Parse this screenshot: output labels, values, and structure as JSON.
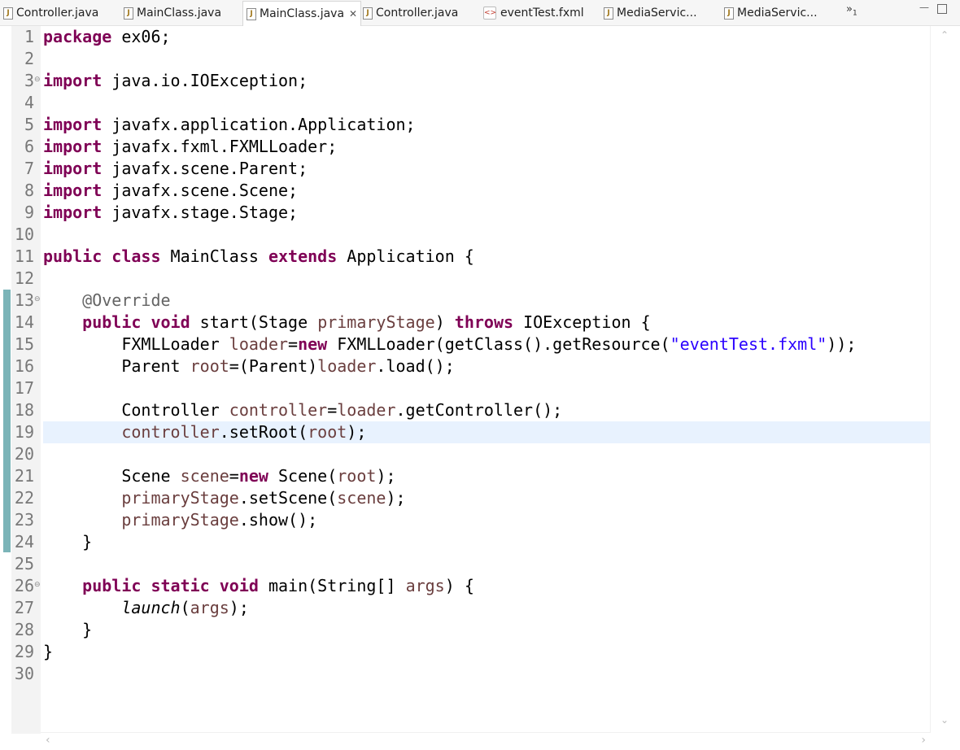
{
  "tabs": [
    {
      "label": "Controller.java",
      "icon": "java-file-icon"
    },
    {
      "label": "MainClass.java",
      "icon": "java-file-icon"
    },
    {
      "label": "MainClass.java",
      "icon": "java-file-icon",
      "active": true
    },
    {
      "label": "Controller.java",
      "icon": "java-file-icon"
    },
    {
      "label": "eventTest.fxml",
      "icon": "xml-file-icon"
    },
    {
      "label": "MediaServic...",
      "icon": "java-file-icon"
    },
    {
      "label": "MediaServic...",
      "icon": "java-file-icon"
    }
  ],
  "tab_overflow": {
    "symbol": "»",
    "count": "1"
  },
  "file_icon_glyph": "J",
  "xml_icon_glyph": "<>",
  "close_glyph": "✕",
  "colors": {
    "keyword": "#7f0055",
    "string": "#2a00ff",
    "annotation": "#646464",
    "variable": "#6a3e3e",
    "current_line": "#e8f2fe",
    "change_bar": "#7bb4b8"
  },
  "editor": {
    "current_line": 19,
    "lines": [
      {
        "n": "1",
        "code": "<span class=\"kw\">package</span> ex06;"
      },
      {
        "n": "2",
        "code": ""
      },
      {
        "n": "3",
        "fold": true,
        "code": "<span class=\"kw\">import</span> java.io.IOException;"
      },
      {
        "n": "4",
        "code": ""
      },
      {
        "n": "5",
        "code": "<span class=\"kw\">import</span> javafx.application.Application;"
      },
      {
        "n": "6",
        "code": "<span class=\"kw\">import</span> javafx.fxml.FXMLLoader;"
      },
      {
        "n": "7",
        "code": "<span class=\"kw\">import</span> javafx.scene.Parent;"
      },
      {
        "n": "8",
        "code": "<span class=\"kw\">import</span> javafx.scene.Scene;"
      },
      {
        "n": "9",
        "code": "<span class=\"kw\">import</span> javafx.stage.Stage;"
      },
      {
        "n": "10",
        "code": ""
      },
      {
        "n": "11",
        "code": "<span class=\"kw\">public</span> <span class=\"kw\">class</span> MainClass <span class=\"kw\">extends</span> Application {"
      },
      {
        "n": "12",
        "code": ""
      },
      {
        "n": "13",
        "fold": true,
        "code": "    <span class=\"ann\">@Override</span>"
      },
      {
        "n": "14",
        "code": "    <span class=\"kw\">public</span> <span class=\"kw\">void</span> start(Stage <span class=\"var\">primaryStage</span>) <span class=\"kw\">throws</span> IOException {"
      },
      {
        "n": "15",
        "code": "        FXMLLoader <span class=\"var\">loader</span>=<span class=\"kw\">new</span> FXMLLoader(getClass().getResource(<span class=\"str\">\"eventTest.fxml\"</span>));"
      },
      {
        "n": "16",
        "code": "        Parent <span class=\"var\">root</span>=(Parent)<span class=\"var\">loader</span>.load();"
      },
      {
        "n": "17",
        "code": ""
      },
      {
        "n": "18",
        "code": "        Controller <span class=\"var\">controller</span>=<span class=\"var\">loader</span>.getController();"
      },
      {
        "n": "19",
        "code": "        <span class=\"var\">controller</span>.setRoot(<span class=\"var\">root</span>);"
      },
      {
        "n": "20",
        "code": ""
      },
      {
        "n": "21",
        "code": "        Scene <span class=\"var\">scene</span>=<span class=\"kw\">new</span> Scene(<span class=\"var\">root</span>);"
      },
      {
        "n": "22",
        "code": "        <span class=\"var\">primaryStage</span>.setScene(<span class=\"var\">scene</span>);"
      },
      {
        "n": "23",
        "code": "        <span class=\"var\">primaryStage</span>.show();"
      },
      {
        "n": "24",
        "code": "    }"
      },
      {
        "n": "25",
        "code": ""
      },
      {
        "n": "26",
        "fold": true,
        "code": "    <span class=\"kw\">public</span> <span class=\"kw\">static</span> <span class=\"kw\">void</span> main(String[] <span class=\"var\">args</span>) {"
      },
      {
        "n": "27",
        "code": "        <span class=\"it\">launch</span>(<span class=\"var\">args</span>);"
      },
      {
        "n": "28",
        "code": "    }"
      },
      {
        "n": "29",
        "code": "}"
      },
      {
        "n": "30",
        "code": ""
      }
    ]
  }
}
